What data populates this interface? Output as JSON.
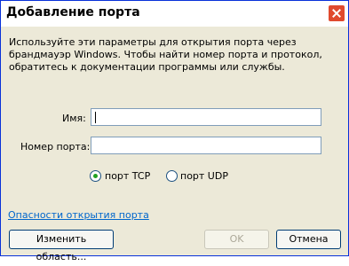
{
  "dialog": {
    "title": "Добавление порта",
    "description": "Используйте эти параметры для открытия порта через брандмауэр Windows. Чтобы найти номер порта и протокол, обратитесь к документации программы или службы.",
    "name_label": "Имя:",
    "name_value": "",
    "port_label": "Номер порта:",
    "port_value": "",
    "protocol": {
      "tcp_label": "порт TCP",
      "udp_label": "порт UDP",
      "selected": "TCP"
    },
    "risk_link": "Опасности открытия порта",
    "buttons": {
      "change_scope": "Изменить область...",
      "ok": "OK",
      "cancel": "Отмена"
    }
  }
}
